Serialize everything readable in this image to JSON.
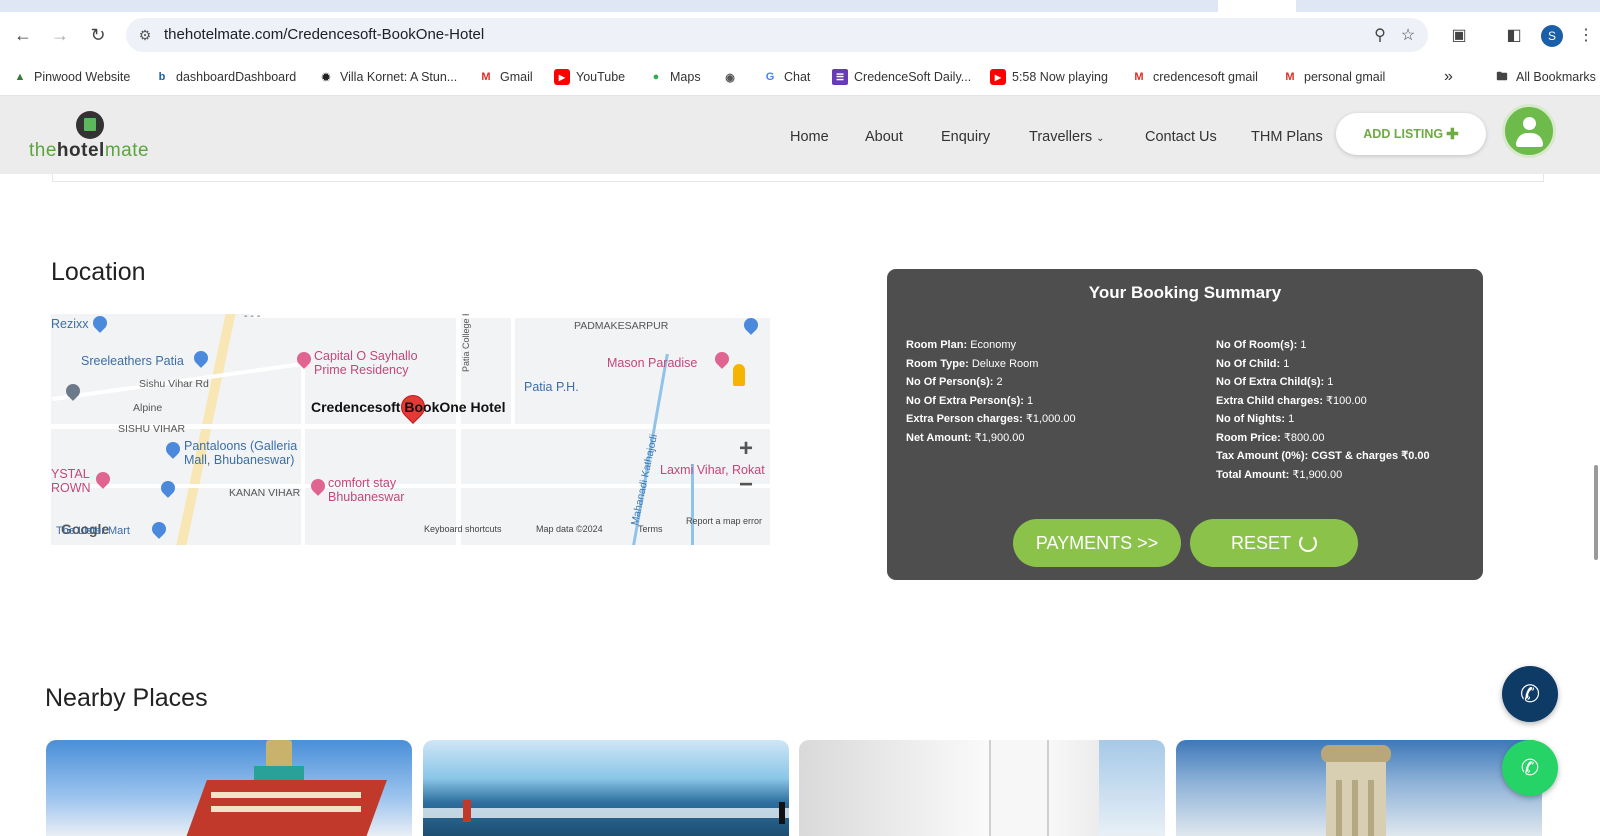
{
  "browser": {
    "url": "thehotelmate.com/Credencesoft-BookOne-Hotel",
    "profile_initial": "S",
    "bookmarks": [
      {
        "label": "Pinwood Website",
        "icon": "pinwood-icon",
        "color": "#3a7a3a"
      },
      {
        "label": "dashboardDashboard",
        "icon": "bookone-b-icon",
        "color": "#1a5fa8"
      },
      {
        "label": "Villa Kornet: A Stun...",
        "icon": "villa-icon",
        "color": "#222222"
      },
      {
        "label": "Gmail",
        "icon": "gmail-icon",
        "color": "#d93025"
      },
      {
        "label": "YouTube",
        "icon": "youtube-icon",
        "color": "#ff0000"
      },
      {
        "label": "Maps",
        "icon": "maps-pin-icon",
        "color": "#34a853"
      },
      {
        "label": "",
        "icon": "globe-icon",
        "color": "#555555"
      },
      {
        "label": "Chat",
        "icon": "google-g-icon",
        "color": "#4285f4"
      },
      {
        "label": "CredenceSoft Daily...",
        "icon": "forms-icon",
        "color": "#673ab7"
      },
      {
        "label": "5:58 Now playing",
        "icon": "youtube-icon",
        "color": "#ff0000"
      },
      {
        "label": "credencesoft gmail",
        "icon": "gmail-icon",
        "color": "#d93025"
      },
      {
        "label": "personal gmail",
        "icon": "gmail-icon",
        "color": "#d93025"
      }
    ],
    "all_bookmarks": "All Bookmarks"
  },
  "site": {
    "logo": {
      "part1": "the",
      "part2": "hotel",
      "part3": "mate"
    },
    "menu": [
      "Home",
      "About",
      "Enquiry",
      "Travellers",
      "Contact Us",
      "THM Plans"
    ],
    "add_listing": "ADD LISTING"
  },
  "location": {
    "title": "Location",
    "map": {
      "hotel_label": "Credencesoft BookOne Hotel",
      "labels": {
        "rezixx": "Rezixx",
        "sreeleathers": "Sreeleathers Patia",
        "capital": "Capital O Sayhallo",
        "capital2": "Prime Residency",
        "padmakesarpur": "PADMAKESARPUR",
        "mason": "Mason Paradise",
        "patia_ph": "Patia P.H.",
        "sishu_vihar_rd": "Sishu Vihar Rd",
        "alpine": "Alpine",
        "sishu_vihar": "SISHU VIHAR",
        "pantaloons": "Pantaloons (Galleria",
        "pantaloons2": "Mall, Bhubaneswar)",
        "crystal": "YSTAL",
        "crown": "ROWN",
        "kanan_vihar": "KANAN VIHAR",
        "comfort": "comfort stay",
        "comfort2": "Bhubaneswar",
        "mahanadi": "Mahanadi Kathajodi",
        "laxmi": "Laxmi Vihar, Rokat",
        "patia_college": "Patia College Rd",
        "mart": "The Lister Mart",
        "google": "Google",
        "shortcuts": "Keyboard shortcuts",
        "mapdata": "Map data ©2024",
        "terms": "Terms",
        "report": "Report a map error"
      }
    }
  },
  "booking": {
    "title": "Your Booking Summary",
    "left": [
      {
        "key": "Room Plan:",
        "value": "Economy"
      },
      {
        "key": "Room Type:",
        "value": "Deluxe Room"
      },
      {
        "key": "No Of Person(s):",
        "value": "2"
      },
      {
        "key": "No Of Extra Person(s):",
        "value": "1"
      },
      {
        "key": "Extra Person charges:",
        "value": "₹1,000.00"
      },
      {
        "key": "Net Amount:",
        "value": "₹1,900.00"
      }
    ],
    "right": [
      {
        "key": "No Of Room(s):",
        "value": "1"
      },
      {
        "key": "No Of Child:",
        "value": "1"
      },
      {
        "key": "No Of Extra Child(s):",
        "value": "1"
      },
      {
        "key": "Extra Child charges:",
        "value": "₹100.00"
      },
      {
        "key": "No of Nights:",
        "value": "1"
      },
      {
        "key": "Room Price:",
        "value": "₹800.00"
      },
      {
        "key": "Tax Amount (0%): CGST & charges",
        "value": "₹0.00"
      },
      {
        "key": "Total Amount:",
        "value": "₹1,900.00"
      }
    ],
    "payments": "PAYMENTS >>",
    "reset": "RESET"
  },
  "nearby": {
    "title": "Nearby Places"
  },
  "colors": {
    "accent_green": "#8bc34a",
    "summary_bg": "#4e4e4e",
    "phone_btn": "#0d3b66",
    "whatsapp_btn": "#25d366"
  }
}
